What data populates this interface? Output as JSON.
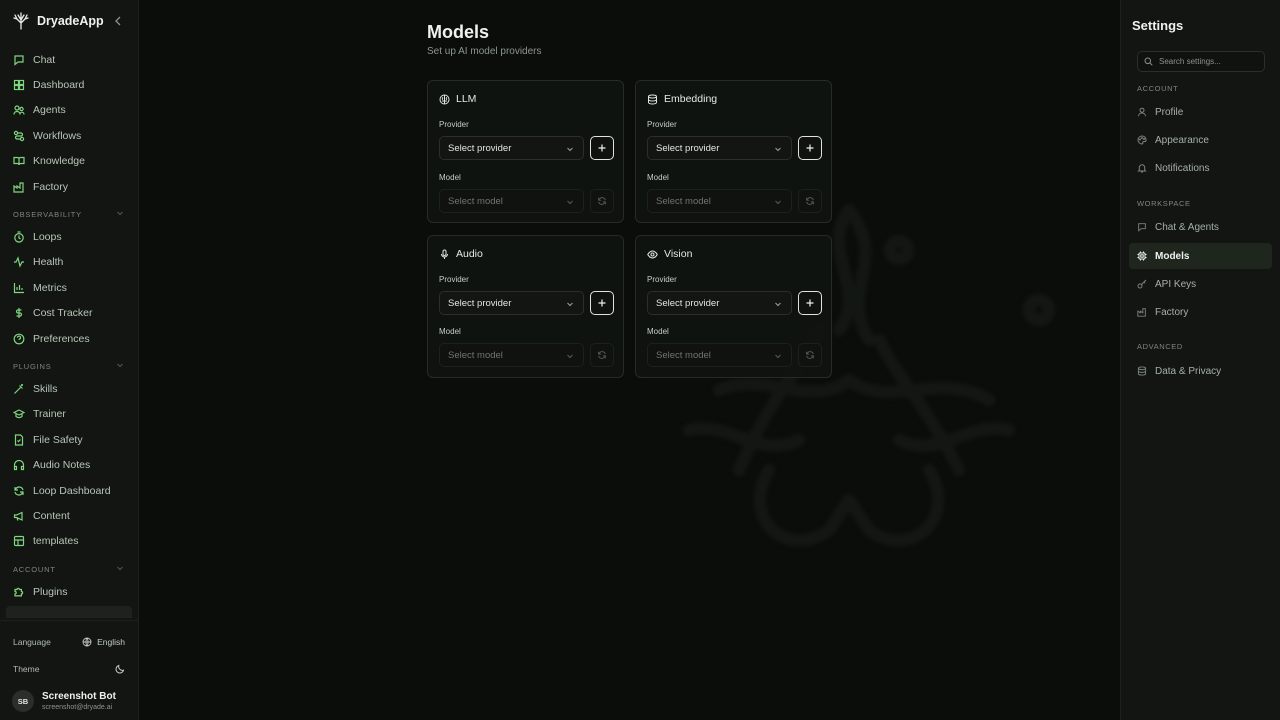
{
  "app": {
    "name": "DryadeApp"
  },
  "sidebar": {
    "items_top": [
      {
        "label": "Chat",
        "icon": "chat-icon"
      },
      {
        "label": "Dashboard",
        "icon": "dashboard-icon"
      },
      {
        "label": "Agents",
        "icon": "agents-icon"
      },
      {
        "label": "Workflows",
        "icon": "workflows-icon"
      },
      {
        "label": "Knowledge",
        "icon": "book-icon"
      },
      {
        "label": "Factory",
        "icon": "factory-icon"
      }
    ],
    "section_observability": "OBSERVABILITY",
    "items_observability": [
      {
        "label": "Loops",
        "icon": "timer-icon"
      },
      {
        "label": "Health",
        "icon": "activity-icon"
      },
      {
        "label": "Metrics",
        "icon": "bar-chart-icon"
      },
      {
        "label": "Cost Tracker",
        "icon": "dollar-icon"
      },
      {
        "label": "Preferences",
        "icon": "help-circle-icon"
      }
    ],
    "section_plugins": "PLUGINS",
    "items_plugins": [
      {
        "label": "Skills",
        "icon": "wand-icon"
      },
      {
        "label": "Trainer",
        "icon": "graduation-cap-icon"
      },
      {
        "label": "File Safety",
        "icon": "file-shield-icon"
      },
      {
        "label": "Audio Notes",
        "icon": "headphones-icon"
      },
      {
        "label": "Loop Dashboard",
        "icon": "refresh-icon"
      },
      {
        "label": "Content",
        "icon": "megaphone-icon"
      },
      {
        "label": "templates",
        "icon": "template-icon"
      }
    ],
    "section_account": "ACCOUNT",
    "items_account": [
      {
        "label": "Plugins",
        "icon": "puzzle-icon"
      }
    ],
    "footer": {
      "language_label": "Language",
      "language_value": "English",
      "theme_label": "Theme",
      "user_initials": "SB",
      "user_name": "Screenshot Bot",
      "user_email": "screenshot@dryade.ai"
    }
  },
  "main": {
    "title": "Models",
    "subtitle": "Set up AI model providers",
    "cards": [
      {
        "title": "LLM",
        "icon": "brain-icon",
        "provider_label": "Provider",
        "provider_value": "Select provider",
        "model_label": "Model",
        "model_value": "Select model"
      },
      {
        "title": "Embedding",
        "icon": "database-icon",
        "provider_label": "Provider",
        "provider_value": "Select provider",
        "model_label": "Model",
        "model_value": "Select model"
      },
      {
        "title": "Audio",
        "icon": "mic-icon",
        "provider_label": "Provider",
        "provider_value": "Select provider",
        "model_label": "Model",
        "model_value": "Select model"
      },
      {
        "title": "Vision",
        "icon": "eye-icon",
        "provider_label": "Provider",
        "provider_value": "Select provider",
        "model_label": "Model",
        "model_value": "Select model"
      }
    ]
  },
  "settings": {
    "title": "Settings",
    "search_placeholder": "Search settings...",
    "section_account": "ACCOUNT",
    "section_workspace": "WORKSPACE",
    "section_advanced": "ADVANCED",
    "account_items": [
      {
        "label": "Profile",
        "icon": "user-icon"
      },
      {
        "label": "Appearance",
        "icon": "palette-icon"
      },
      {
        "label": "Notifications",
        "icon": "bell-icon"
      }
    ],
    "workspace_items": [
      {
        "label": "Chat & Agents",
        "icon": "chat-icon"
      },
      {
        "label": "Models",
        "icon": "cpu-icon",
        "active": true
      },
      {
        "label": "API Keys",
        "icon": "key-icon"
      },
      {
        "label": "Factory",
        "icon": "factory-icon"
      }
    ],
    "advanced_items": [
      {
        "label": "Data & Privacy",
        "icon": "database-icon"
      }
    ]
  },
  "colors": {
    "accent": "#7fd67f",
    "background": "#0b0d0b",
    "panel": "#121512",
    "active": "#1e261e"
  }
}
